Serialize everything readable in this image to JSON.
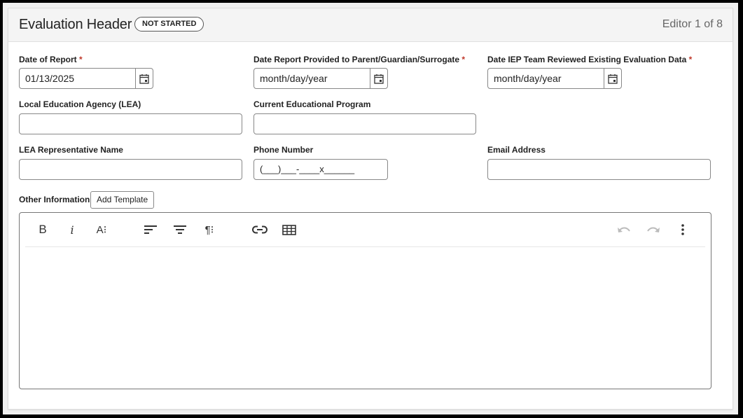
{
  "header": {
    "title": "Evaluation Header",
    "status_badge": "NOT STARTED",
    "editor_position": "Editor 1 of 8"
  },
  "fields": {
    "date_of_report": {
      "label": "Date of Report",
      "required": "*",
      "value": "01/13/2025"
    },
    "date_report_provided": {
      "label": "Date Report Provided to Parent/Guardian/Surrogate",
      "required": "*",
      "placeholder": "month/day/year"
    },
    "date_iep_reviewed": {
      "label": "Date IEP Team Reviewed Existing Evaluation Data",
      "required": "*",
      "placeholder": "month/day/year"
    },
    "lea": {
      "label": "Local Education Agency (LEA)",
      "value": ""
    },
    "current_program": {
      "label": "Current Educational Program",
      "value": ""
    },
    "lea_rep_name": {
      "label": "LEA Representative Name",
      "value": ""
    },
    "phone": {
      "label": "Phone Number",
      "placeholder": "(___)___-____x______"
    },
    "email": {
      "label": "Email Address",
      "value": ""
    },
    "other_information": {
      "label": "Other Information",
      "add_template_label": "Add Template"
    }
  },
  "editor_toolbar": {
    "buttons": [
      {
        "name": "bold",
        "icon": "bold-icon",
        "glyph": "B"
      },
      {
        "name": "italic",
        "icon": "italic-icon",
        "glyph": "i"
      },
      {
        "name": "font-size",
        "icon": "font-size-icon",
        "glyph": "A⁝"
      },
      {
        "name": "align-left",
        "icon": "align-left-icon"
      },
      {
        "name": "align-center",
        "icon": "align-center-icon"
      },
      {
        "name": "paragraph-format",
        "icon": "paragraph-icon",
        "glyph": "¶⁝"
      },
      {
        "name": "insert-link",
        "icon": "link-icon"
      },
      {
        "name": "insert-table",
        "icon": "table-icon"
      },
      {
        "name": "undo",
        "icon": "undo-icon",
        "disabled": true
      },
      {
        "name": "redo",
        "icon": "redo-icon",
        "disabled": true
      },
      {
        "name": "more",
        "icon": "more-vertical-icon"
      }
    ]
  },
  "colors": {
    "required": "#c0392b",
    "header_bg": "#f4f4f4",
    "border": "#888888"
  }
}
